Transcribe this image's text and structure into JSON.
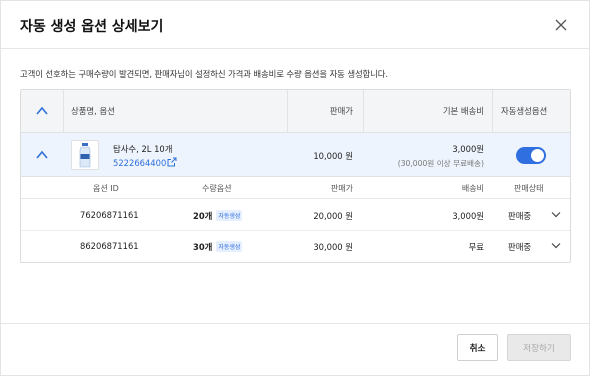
{
  "modal": {
    "title": "자동 생성 옵션 상세보기",
    "description": "고객이 선호하는 구매수량이 발견되면, 판매자님이 설정하신 가격과 배송비로 수량 옵션을 자동 생성합니다.",
    "close_icon": "close-icon"
  },
  "table": {
    "headers": {
      "product": "상품명, 옵션",
      "price": "판매가",
      "shipping": "기본 배송비",
      "auto_option": "자동생성옵션"
    },
    "product": {
      "name": "탐사수, 2L 10개",
      "id": "5222664400",
      "price": "10,000 원",
      "shipping": "3,000원",
      "shipping_note": "(30,000원 이상 무료배송)",
      "auto_generate_on": true
    },
    "sub_headers": {
      "option_id": "옵션 ID",
      "quantity_option": "수량옵션",
      "price": "판매가",
      "shipping": "배송비",
      "status": "판매상태"
    },
    "options": [
      {
        "option_id": "76206871161",
        "qty": "20개",
        "badge": "자동생성",
        "price": "20,000 원",
        "shipping": "3,000원",
        "status": "판매중"
      },
      {
        "option_id": "86206871161",
        "qty": "30개",
        "badge": "자동생성",
        "price": "30,000 원",
        "shipping": "무료",
        "status": "판매중"
      }
    ]
  },
  "footer": {
    "cancel_label": "취소",
    "save_label": "저장하기",
    "save_enabled": false
  },
  "colors": {
    "accent": "#2f6fe0",
    "link": "#2f6fd8",
    "header_bg": "#f4f5f7",
    "selected_row_bg": "#eef4fd",
    "disabled_button_bg": "#e9e9e9"
  }
}
